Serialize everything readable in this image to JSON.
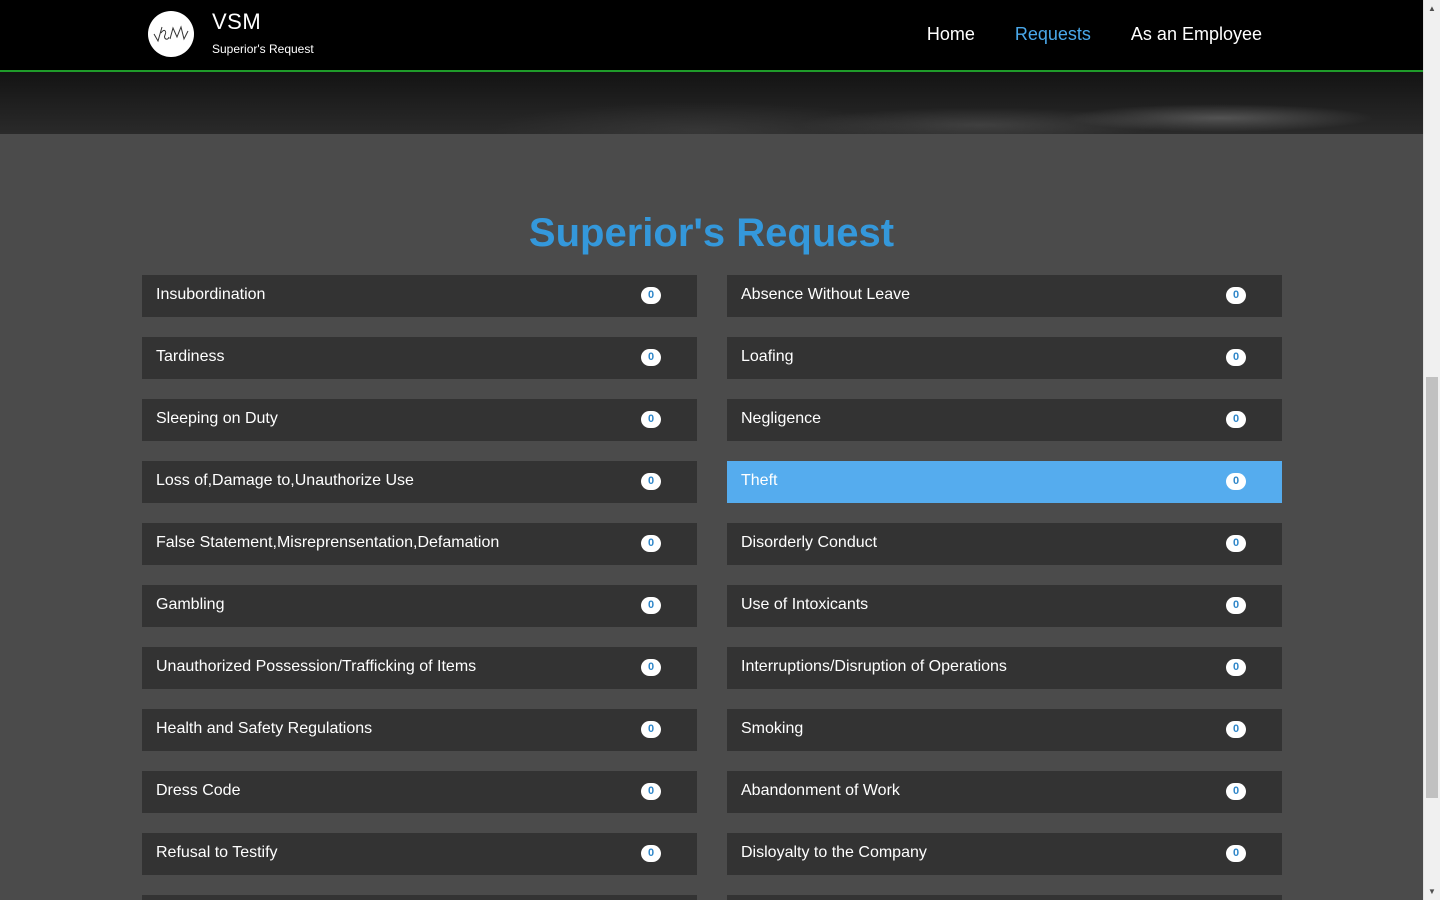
{
  "navbar": {
    "brand_title": "VSM",
    "brand_subtitle": "Superior's Request",
    "links": [
      {
        "label": "Home",
        "active": false
      },
      {
        "label": "Requests",
        "active": true
      },
      {
        "label": "As an Employee",
        "active": false
      }
    ]
  },
  "main": {
    "heading": "Superior's Request",
    "items": [
      {
        "label": "Insubordination",
        "count": "0"
      },
      {
        "label": "Absence Without Leave",
        "count": "0"
      },
      {
        "label": "Tardiness",
        "count": "0"
      },
      {
        "label": "Loafing",
        "count": "0"
      },
      {
        "label": "Sleeping on Duty",
        "count": "0"
      },
      {
        "label": "Negligence",
        "count": "0"
      },
      {
        "label": "Loss of,Damage to,Unauthorize Use",
        "count": "0"
      },
      {
        "label": "Theft",
        "count": "0",
        "active": true
      },
      {
        "label": "False Statement,Misreprensentation,Defamation",
        "count": "0"
      },
      {
        "label": "Disorderly Conduct",
        "count": "0"
      },
      {
        "label": "Gambling",
        "count": "0"
      },
      {
        "label": "Use of Intoxicants",
        "count": "0"
      },
      {
        "label": "Unauthorized Possession/Trafficking of Items",
        "count": "0"
      },
      {
        "label": "Interruptions/Disruption of Operations",
        "count": "0"
      },
      {
        "label": "Health and Safety Regulations",
        "count": "0"
      },
      {
        "label": "Smoking",
        "count": "0"
      },
      {
        "label": "Dress Code",
        "count": "0"
      },
      {
        "label": "Abandonment of Work",
        "count": "0"
      },
      {
        "label": "Refusal to Testify",
        "count": "0"
      },
      {
        "label": "Disloyalty to the Company",
        "count": "0"
      }
    ]
  },
  "colors": {
    "accent": "#3498db",
    "active_item": "#55acee",
    "item_bg": "#333333",
    "page_bg": "#4b4b4b",
    "nav_border": "#1f9b2a"
  },
  "icons": {
    "logo": "vsm-logo-icon",
    "scroll_up": "scroll-up-arrow-icon",
    "scroll_down": "scroll-down-arrow-icon"
  }
}
